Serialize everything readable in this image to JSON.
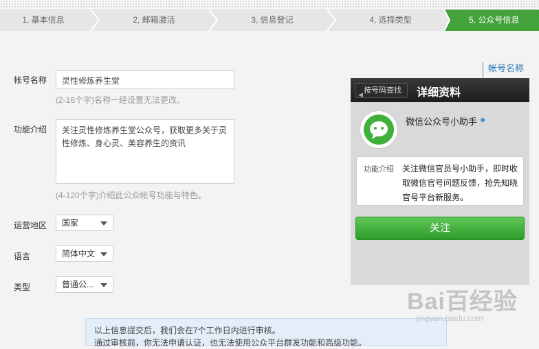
{
  "steps": [
    {
      "label": "1, 基本信息"
    },
    {
      "label": "2, 邮箱激活"
    },
    {
      "label": "3, 信息登记"
    },
    {
      "label": "4, 选择类型"
    },
    {
      "label": "5, 公众号信息"
    }
  ],
  "form": {
    "account_name": {
      "label": "帐号名称",
      "value": "灵性修炼养生堂",
      "hint": "(2-16个字)名称一经设置无法更改。"
    },
    "intro": {
      "label": "功能介绍",
      "value": "关注灵性修炼养生堂公众号，获取更多关于灵性修炼、身心灵、美容养生的资讯",
      "hint": "(4-120个字)介绍此公众帐号功能与特色。"
    },
    "region": {
      "label": "运营地区",
      "value": "国家"
    },
    "language": {
      "label": "语言",
      "value": "简体中文"
    },
    "type": {
      "label": "类型",
      "value": "普通公..."
    }
  },
  "notice": {
    "line1": "以上信息提交后，我们会在7个工作日内进行审核。",
    "line2": "通过审核前，你无法申请认证，也无法使用公众平台群发功能和高级功能。"
  },
  "preview": {
    "callout": "帐号名称",
    "back_label": "按号码查找",
    "title": "详细资料",
    "account_name": "微信公众号小助手",
    "intro_label": "功能介绍",
    "intro_text": "关注微信官员号小助手，即时收取微信官号问题反馈，抢先知晓官号平台新服务。",
    "follow_label": "关注"
  },
  "watermark": {
    "main": "Bai百经验",
    "sub": "jingyan.baidu.com"
  },
  "colors": {
    "accent_green": "#45a33b",
    "button_green": "#3fb03a",
    "callout_blue": "#2a7ab5"
  }
}
